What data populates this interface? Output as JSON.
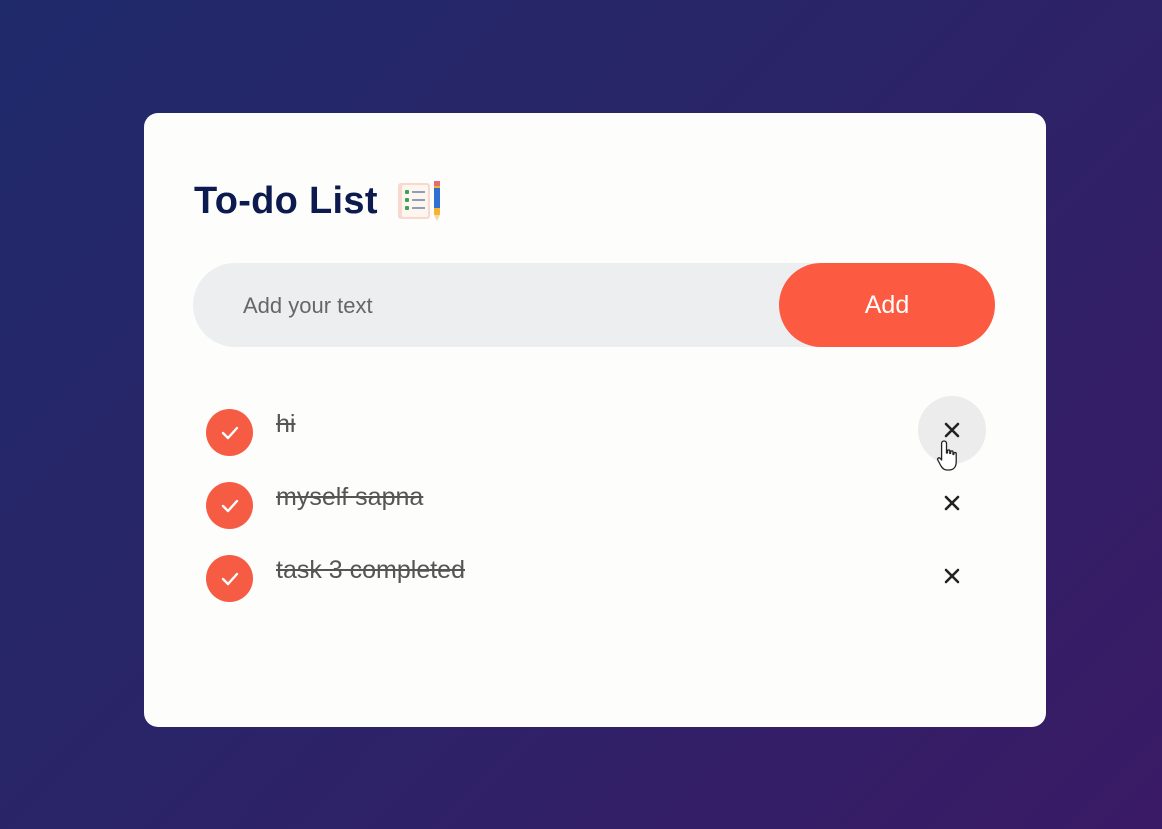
{
  "app": {
    "title": "To-do List",
    "title_icon": "notepad-checklist-icon"
  },
  "input": {
    "placeholder": "Add your text",
    "value": ""
  },
  "add_button": {
    "label": "Add"
  },
  "colors": {
    "accent": "#fd5a42",
    "title": "#0c1a4f",
    "card": "#fdfdfc",
    "input_bg": "#edeef0"
  },
  "tasks": [
    {
      "text": "hi",
      "completed": true,
      "delete_icon": "close-icon"
    },
    {
      "text": "myself sapna",
      "completed": true,
      "delete_icon": "close-icon"
    },
    {
      "text": "task 3 completed",
      "completed": true,
      "delete_icon": "close-icon"
    }
  ]
}
